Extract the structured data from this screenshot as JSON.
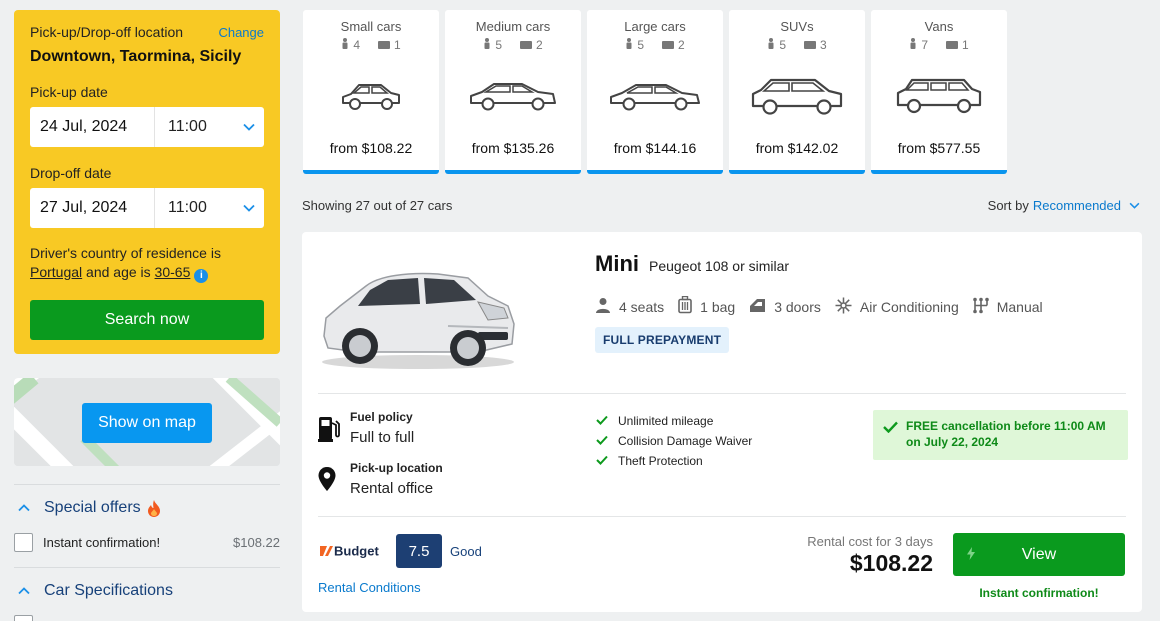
{
  "search": {
    "location_label": "Pick-up/Drop-off location",
    "change_label": "Change",
    "location_value": "Downtown, Taormina, Sicily",
    "pickup_label": "Pick-up date",
    "pickup_date": "24 Jul, 2024",
    "pickup_time": "11:00",
    "dropoff_label": "Drop-off date",
    "dropoff_date": "27 Jul, 2024",
    "dropoff_time": "11:00",
    "country_prefix": "Driver's country of residence is",
    "country": "Portugal",
    "age_prefix": "and age is",
    "age": "30-65",
    "search_button": "Search now"
  },
  "map": {
    "button": "Show on map"
  },
  "filters": {
    "special_offers": "Special offers",
    "instant_confirmation": "Instant confirmation!",
    "instant_price": "$108.22",
    "car_specs": "Car Specifications"
  },
  "categories": [
    {
      "name": "Small cars",
      "seats": "4",
      "bags": "1",
      "price": "from $108.22"
    },
    {
      "name": "Medium cars",
      "seats": "5",
      "bags": "2",
      "price": "from $135.26"
    },
    {
      "name": "Large cars",
      "seats": "5",
      "bags": "2",
      "price": "from $144.16"
    },
    {
      "name": "SUVs",
      "seats": "5",
      "bags": "3",
      "price": "from $142.02"
    },
    {
      "name": "Vans",
      "seats": "7",
      "bags": "1",
      "price": "from $577.55"
    }
  ],
  "results": {
    "showing": "Showing 27 out of 27 cars",
    "sort_label": "Sort by",
    "sort_value": "Recommended"
  },
  "car": {
    "name": "Mini",
    "model": "Peugeot 108 or similar",
    "seats": "4 seats",
    "bags": "1 bag",
    "doors": "3 doors",
    "ac": "Air Conditioning",
    "transmission": "Manual",
    "prepayment": "FULL PREPAYMENT",
    "fuel_title": "Fuel policy",
    "fuel_value": "Full to full",
    "pickup_title": "Pick-up location",
    "pickup_value": "Rental office",
    "inclusions": [
      "Unlimited mileage",
      "Collision Damage Waiver",
      "Theft Protection"
    ],
    "free_cancel": "FREE cancellation before 11:00 AM on July 22, 2024",
    "supplier": "Budget",
    "rating": "7.5",
    "rating_word": "Good",
    "conditions": "Rental Conditions",
    "cost_label": "Rental cost for 3 days",
    "cost_value": "$108.22",
    "view_button": "View",
    "instant": "Instant confirmation!"
  },
  "colors": {
    "panel_yellow": "#f8c924",
    "primary_green": "#0a9a1e",
    "link_blue": "#0a7acd",
    "accent_blue": "#0a95ee",
    "navy": "#1d3f73"
  }
}
